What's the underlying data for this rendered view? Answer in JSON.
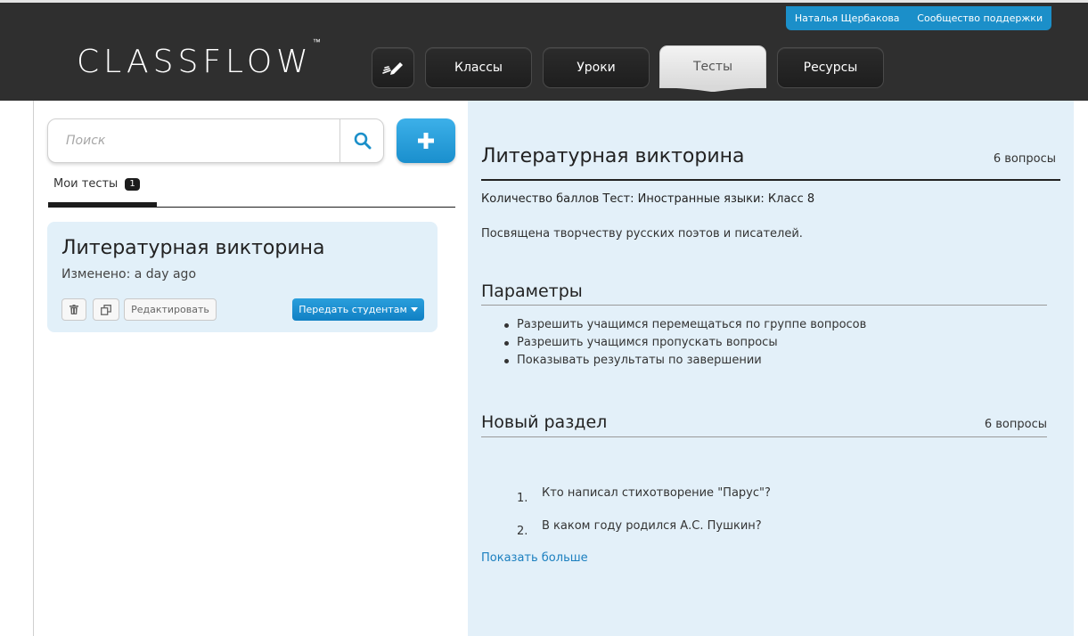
{
  "header": {
    "user_name": "Наталья Щербакова",
    "support_link": "Сообщество поддержки",
    "logo_text": "CLASSFLOW",
    "logo_tm": "™",
    "nav": {
      "classes": "Классы",
      "lessons": "Уроки",
      "tests": "Тесты",
      "resources": "Ресурсы"
    }
  },
  "sidebar": {
    "search_placeholder": "Поиск",
    "tab_label": "Мои тесты",
    "tab_count": "1",
    "card": {
      "title": "Литературная викторина",
      "modified": "Изменено: a day ago",
      "edit_label": "Редактировать",
      "assign_label": "Передать студентам"
    }
  },
  "detail": {
    "title": "Литературная викторина",
    "question_count": "6 вопросы",
    "meta": "Количество баллов Тест: Иностранные языки: Класс 8",
    "description": "Посвящена творчеству русских поэтов и писателей.",
    "params_title": "Параметры",
    "params": [
      "Разрешить учащимся перемещаться по группе вопросов",
      "Разрешить учащимся пропускать вопросы",
      "Показывать результаты по завершении"
    ],
    "section": {
      "title": "Новый раздел",
      "count": "6 вопросы",
      "questions": [
        {
          "num": "1.",
          "text": "Кто написал стихотворение \"Парус\"?"
        },
        {
          "num": "2.",
          "text": "В каком году родился А.С. Пушкин?"
        }
      ]
    },
    "show_more": "Показать больше"
  },
  "colors": {
    "accent": "#1b8fc9",
    "header_bg": "#2f2f2f",
    "panel_bg": "#e3f0f9"
  }
}
